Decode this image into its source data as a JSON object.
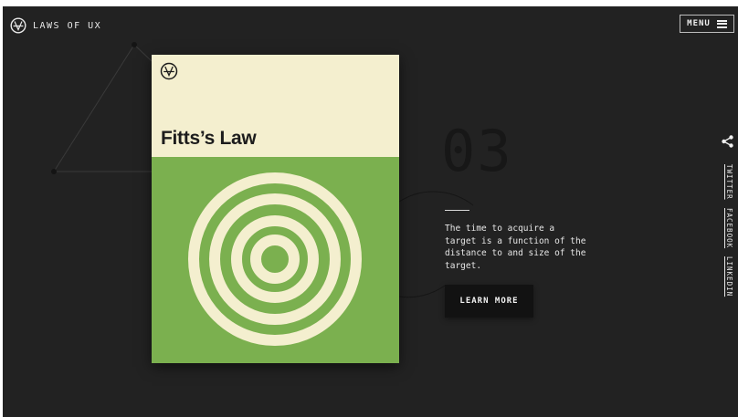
{
  "header": {
    "brand": "LAWS OF UX",
    "menu_label": "MENU"
  },
  "card": {
    "title": "Fitts’s Law",
    "top_color": "#f4efcf",
    "bottom_color": "#7bb04f"
  },
  "law": {
    "number": "03",
    "description": "The time to acquire a target is a function of the distance to and size of the target.",
    "cta": "LEARN MORE"
  },
  "social": {
    "links": [
      "TWITTER",
      "FACEBOOK",
      "LINKEDIN"
    ],
    "share_icon": "share-icon"
  },
  "colors": {
    "background": "#222222",
    "accent_cream": "#f4efcf",
    "accent_green": "#7bb04f"
  }
}
